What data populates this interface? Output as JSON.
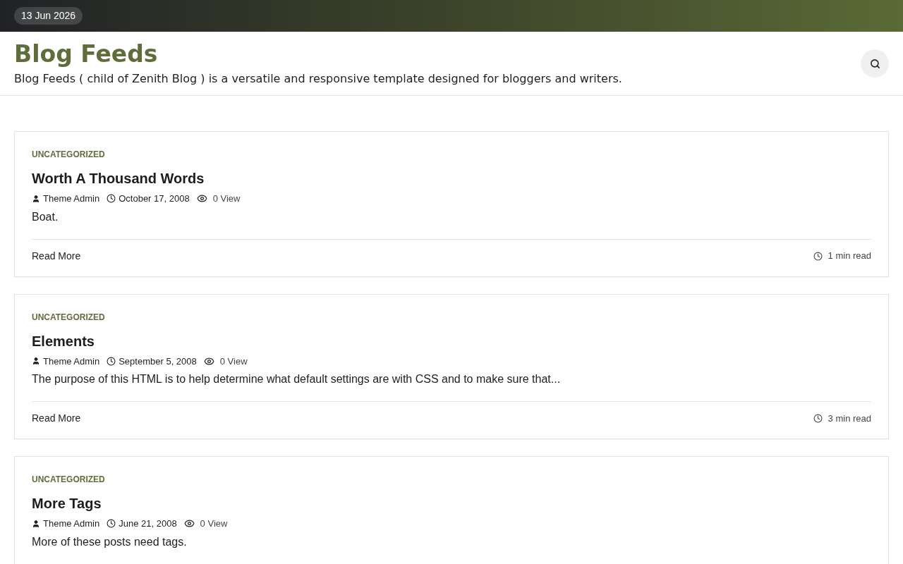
{
  "top_bar": {
    "date": "13 Jun 2026"
  },
  "header": {
    "site_title": "Blog Feeds",
    "tagline": "Blog Feeds ( child of Zenith Blog ) is a versatile and responsive template designed for bloggers and writers."
  },
  "posts": [
    {
      "category": "UNCATEGORIZED",
      "title": "Worth A Thousand Words",
      "author": "Theme Admin",
      "date": "October 17, 2008",
      "views": "0 View",
      "excerpt": "Boat.",
      "read_more": "Read More",
      "read_time": "1 min read"
    },
    {
      "category": "UNCATEGORIZED",
      "title": "Elements",
      "author": "Theme Admin",
      "date": "September 5, 2008",
      "views": "0 View",
      "excerpt": "The purpose of this HTML is to help determine what default settings are with CSS and to make sure that...",
      "read_more": "Read More",
      "read_time": "3 min read"
    },
    {
      "category": "UNCATEGORIZED",
      "title": "More Tags",
      "author": "Theme Admin",
      "date": "June 21, 2008",
      "views": "0 View",
      "excerpt": "More of these posts need tags."
    }
  ]
}
